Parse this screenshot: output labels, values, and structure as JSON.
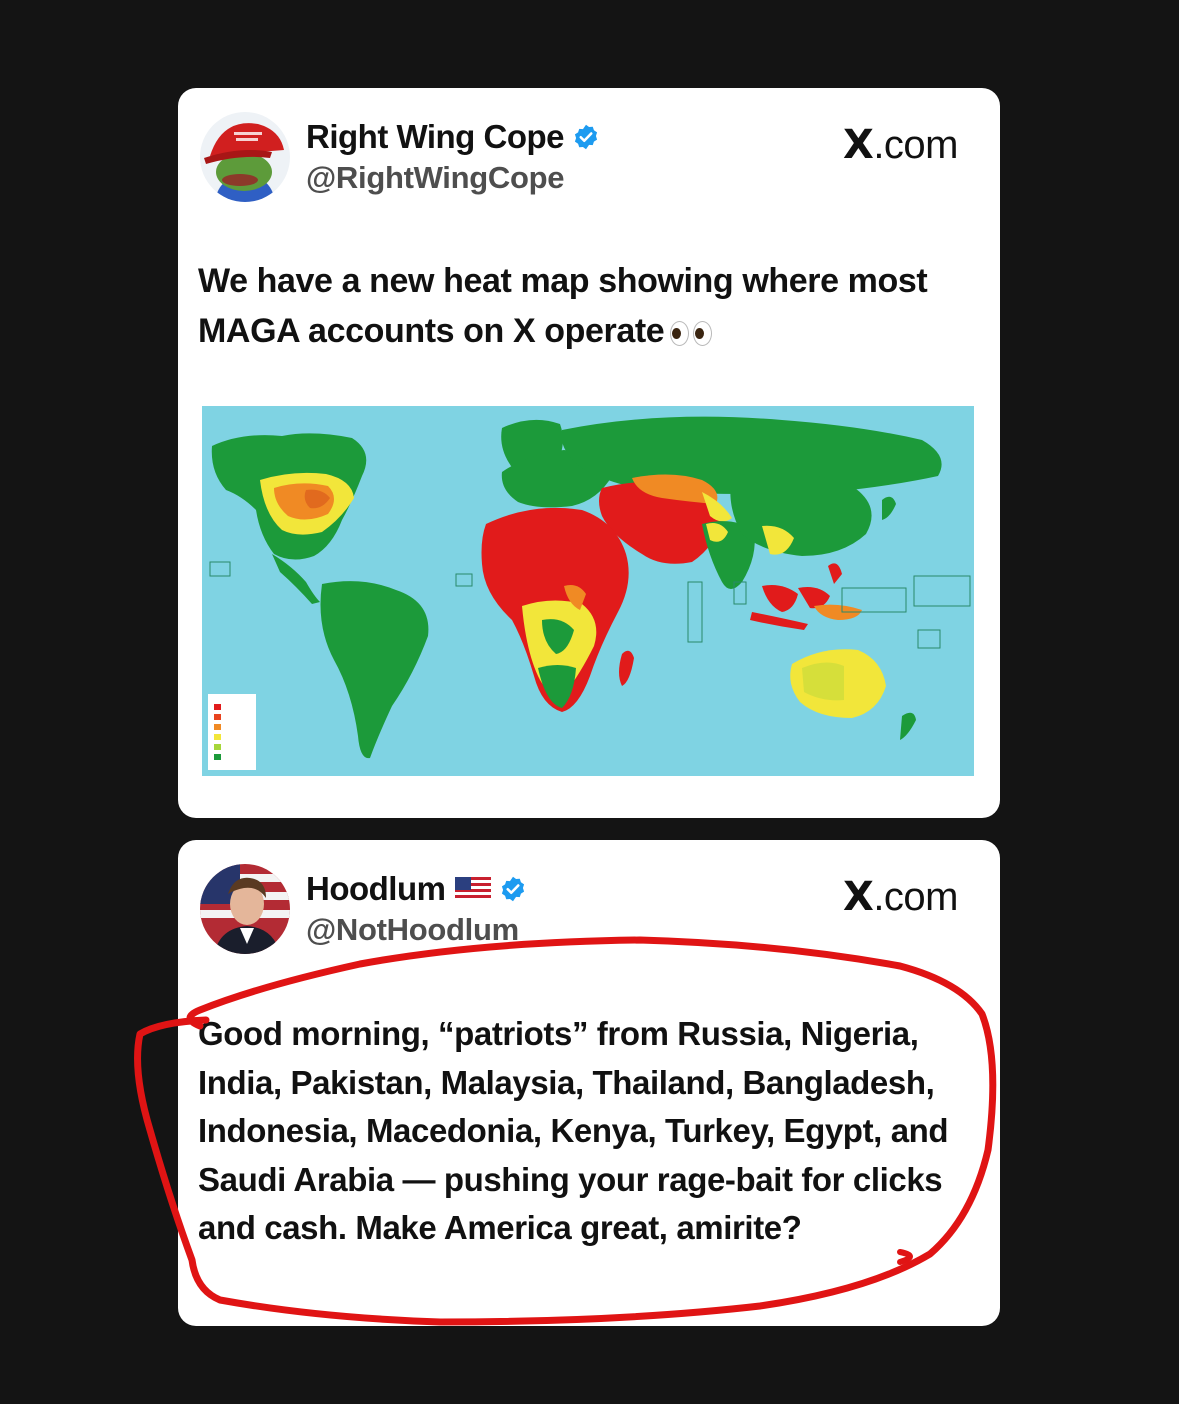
{
  "tweets": [
    {
      "display_name": "Right Wing Cope",
      "handle": "@RightWingCope",
      "brand": "X",
      "brand_suffix": ".com",
      "verified": true,
      "text": "We have a new heat map showing where most MAGA accounts on X operate",
      "emoji": "eyes",
      "media": "world-heat-map"
    },
    {
      "display_name": "Hoodlum",
      "flag": "us-flag",
      "handle": "@NotHoodlum",
      "brand": "X",
      "brand_suffix": ".com",
      "verified": true,
      "text": "Good morning, “patriots” from Russia, Nigeria, India, Pakistan, Malaysia, Thailand, Bangladesh, Indonesia, Macedonia, Kenya, Turkey, Egypt, and Saudi Arabia — pushing your rage-bait for clicks and cash. Make America great, amirite?"
    }
  ],
  "colors": {
    "background": "#141414",
    "card": "#ffffff",
    "verified": "#1d9bf0",
    "ocean": "#7fd3e3",
    "land_green": "#1c9a3a",
    "heat_red": "#e11b1b",
    "heat_orange": "#f08a24",
    "heat_yellow": "#f2e63a",
    "annotation": "#e01414"
  }
}
